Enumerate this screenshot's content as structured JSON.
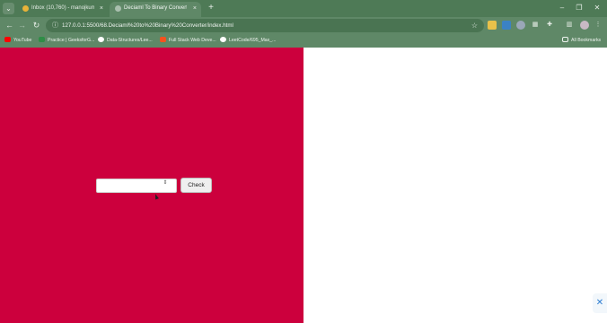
{
  "browser": {
    "tabs": [
      {
        "title": "Inbox (10,760) - manojkumarci...",
        "close": "×"
      },
      {
        "title": "Deciaml To Binary Converter",
        "close": "×"
      }
    ],
    "tab_menu_icon": "chevron-down",
    "new_tab": "+",
    "window_controls": {
      "minimize": "–",
      "maximize": "❐",
      "close": "✕"
    },
    "nav": {
      "back": "←",
      "forward": "→",
      "reload": "↻"
    },
    "url": "127.0.0.1:5500/68.Deciaml%20to%20Binary%20Converter/index.html",
    "info_icon": "ⓘ",
    "star_icon": "☆",
    "bookmarks": [
      {
        "label": "YouTube",
        "color": "#ff0000"
      },
      {
        "label": "Practice | GeeksforG...",
        "color": "#2f8d46"
      },
      {
        "label": "Data-Structures/Lee...",
        "color": "#ffffff"
      },
      {
        "label": "Full Stack Web Deve...",
        "color": "#f4511e"
      },
      {
        "label": "LeetCode/695_Max_...",
        "color": "#ffffff"
      }
    ],
    "all_bookmarks": "All Bookmarks"
  },
  "app": {
    "input_value": "",
    "check_label": "Check",
    "spinner_icon": "⇕",
    "panel_color": "#cc003d"
  }
}
